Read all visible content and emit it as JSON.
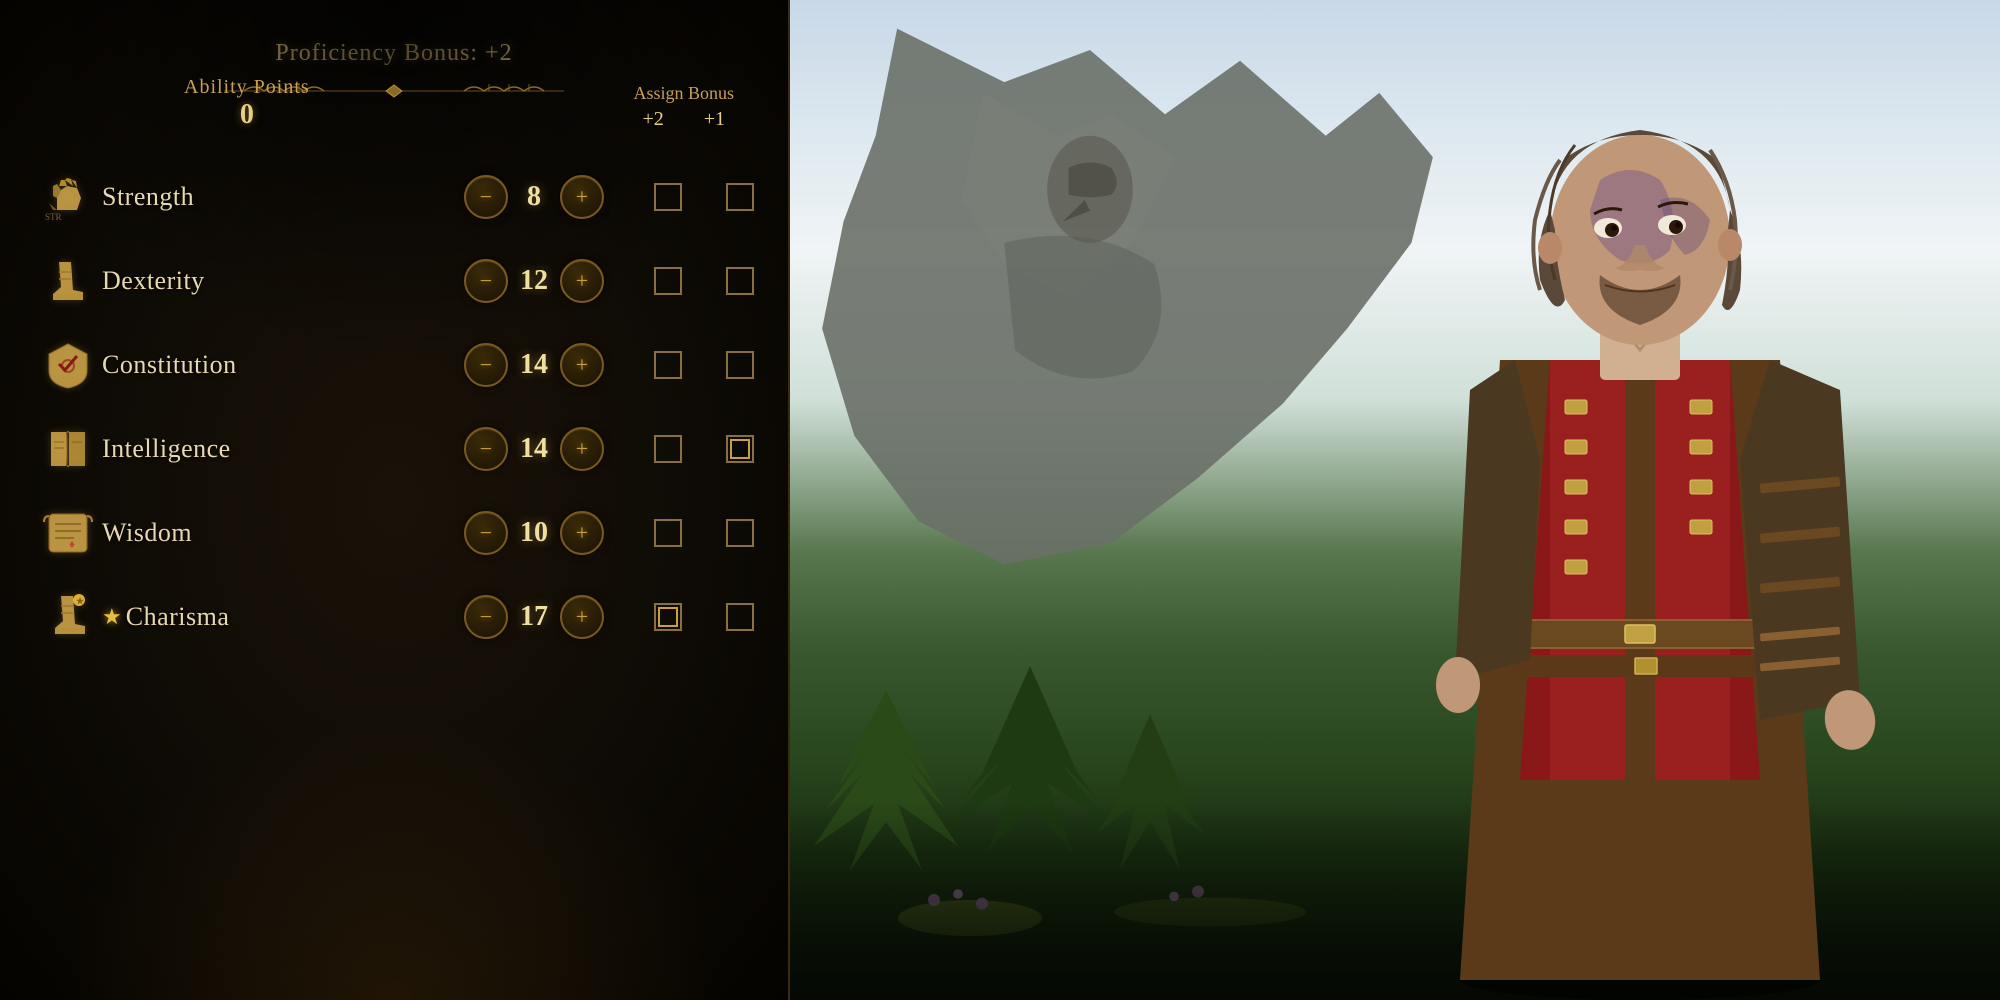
{
  "header": {
    "proficiency_bonus_label": "Proficiency Bonus: +2",
    "ability_points_label": "Ability Points",
    "ability_points_value": "0",
    "assign_bonus_label": "Assign Bonus",
    "assign_bonus_col1": "+2",
    "assign_bonus_col2": "+1"
  },
  "abilities": [
    {
      "id": "strength",
      "name": "Strength",
      "value": 8,
      "has_star": false,
      "bonus_2_checked": false,
      "bonus_1_checked": false,
      "icon": "fist"
    },
    {
      "id": "dexterity",
      "name": "Dexterity",
      "value": 12,
      "has_star": false,
      "bonus_2_checked": false,
      "bonus_1_checked": false,
      "icon": "boot"
    },
    {
      "id": "constitution",
      "name": "Constitution",
      "value": 14,
      "has_star": false,
      "bonus_2_checked": false,
      "bonus_1_checked": false,
      "icon": "shield"
    },
    {
      "id": "intelligence",
      "name": "Intelligence",
      "value": 14,
      "has_star": false,
      "bonus_2_checked": false,
      "bonus_1_checked": true,
      "icon": "book"
    },
    {
      "id": "wisdom",
      "name": "Wisdom",
      "value": 10,
      "has_star": false,
      "bonus_2_checked": false,
      "bonus_1_checked": false,
      "icon": "scroll"
    },
    {
      "id": "charisma",
      "name": "Charisma",
      "value": 17,
      "has_star": true,
      "bonus_2_checked": true,
      "bonus_1_checked": false,
      "icon": "boot2"
    }
  ],
  "buttons": {
    "minus_label": "−",
    "plus_label": "+"
  }
}
